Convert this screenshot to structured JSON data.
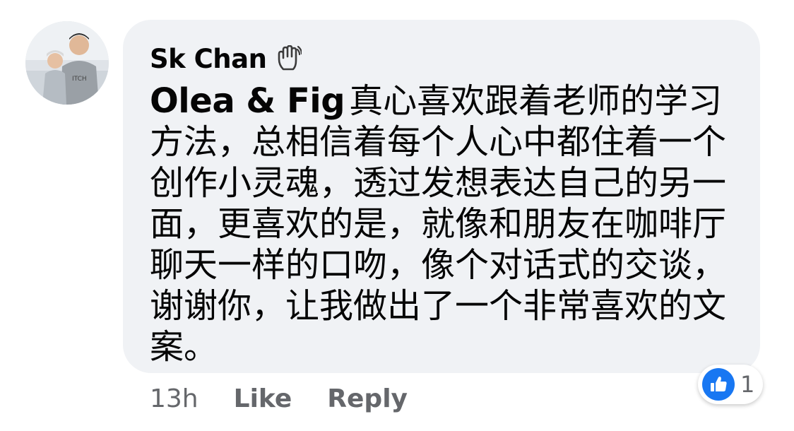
{
  "comment": {
    "author": "Sk Chan",
    "author_badge_icon": "wave-hand-icon",
    "mention": "Olea & Fig",
    "text": "真心喜欢跟着老师的学习方法，总相信着每个人心中都住着一个创作小灵魂，透过发想表达自己的另一面，更喜欢的是，就像和朋友在咖啡厅聊天一样的口吻，像个对话式的交谈，谢谢你，让我做出了一个非常喜欢的文案。"
  },
  "actions": {
    "timestamp": "13h",
    "like_label": "Like",
    "reply_label": "Reply"
  },
  "reactions": {
    "icon": "like-thumb-icon",
    "count": "1",
    "color": "#1877f2"
  },
  "colors": {
    "bubble": "#f0f2f5",
    "text": "#050505",
    "secondary_text": "#65676b"
  }
}
